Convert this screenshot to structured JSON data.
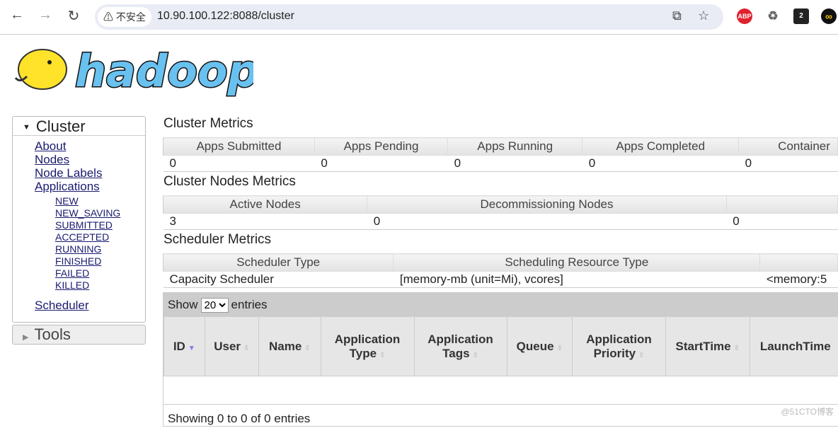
{
  "browser": {
    "security_label": "不安全",
    "url": "10.90.100.122:8088/cluster",
    "ext_abp": "ABP",
    "ext_badge": "2"
  },
  "logo_text": "hadoop",
  "sidebar": {
    "cluster_title": "Cluster",
    "tools_title": "Tools",
    "links": [
      "About",
      "Nodes",
      "Node Labels",
      "Applications"
    ],
    "app_states": [
      "NEW",
      "NEW_SAVING",
      "SUBMITTED",
      "ACCEPTED",
      "RUNNING",
      "FINISHED",
      "FAILED",
      "KILLED"
    ],
    "scheduler": "Scheduler"
  },
  "cluster_metrics": {
    "title": "Cluster Metrics",
    "headers": [
      "Apps Submitted",
      "Apps Pending",
      "Apps Running",
      "Apps Completed",
      "Container"
    ],
    "values": [
      "0",
      "0",
      "0",
      "0",
      "0"
    ]
  },
  "node_metrics": {
    "title": "Cluster Nodes Metrics",
    "headers": [
      "Active Nodes",
      "Decommissioning Nodes",
      ""
    ],
    "values": [
      "3",
      "0",
      "0"
    ]
  },
  "scheduler_metrics": {
    "title": "Scheduler Metrics",
    "headers": [
      "Scheduler Type",
      "Scheduling Resource Type",
      ""
    ],
    "values": [
      "Capacity Scheduler",
      "[memory-mb (unit=Mi), vcores]",
      "<memory:5"
    ]
  },
  "apps": {
    "show": "Show",
    "page_size": "20",
    "entries": "entries",
    "columns": [
      "ID",
      "User",
      "Name",
      "Application Type",
      "Application Tags",
      "Queue",
      "Application Priority",
      "StartTime",
      "LaunchTime"
    ],
    "footer": "Showing 0 to 0 of 0 entries"
  },
  "watermark": "@51CTO博客"
}
